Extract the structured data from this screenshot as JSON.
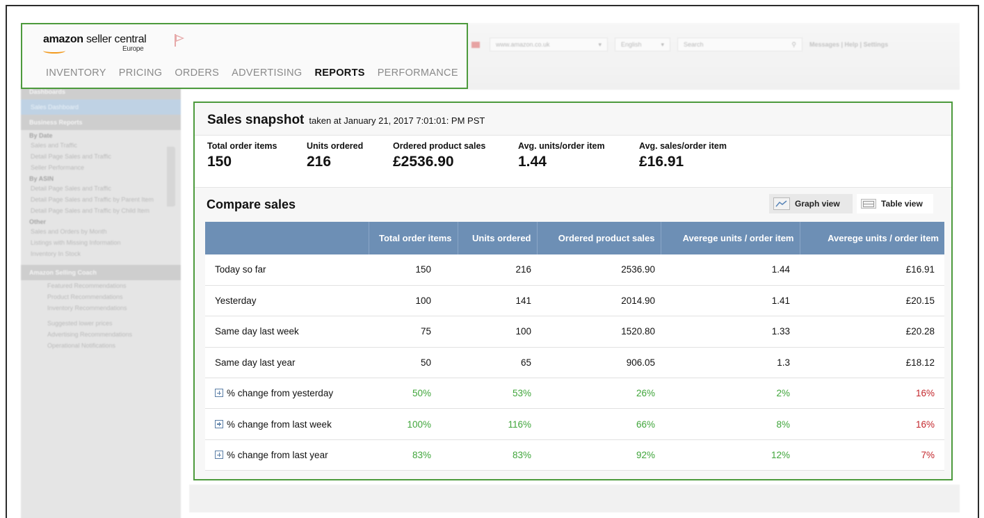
{
  "header": {
    "logo_brand": "amazon",
    "logo_text": "seller central",
    "logo_region": "Europe",
    "nav": [
      "INVENTORY",
      "PRICING",
      "ORDERS",
      "ADVERTISING",
      "REPORTS",
      "PERFORMANCE"
    ],
    "nav_active": "REPORTS",
    "marketplace": "www.amazon.co.uk",
    "language": "English",
    "search_placeholder": "Search",
    "links": "Messages | Help | Settings"
  },
  "sidebar": {
    "sections": [
      {
        "title": "Dashboards",
        "items": [
          {
            "label": "Sales Dashboard",
            "selected": true
          }
        ]
      },
      {
        "title": "Business Reports",
        "groups": [
          {
            "sub": "By Date",
            "items": [
              "Sales and Traffic",
              "Detail Page Sales and Traffic",
              "Seller Performance"
            ]
          },
          {
            "sub": "By ASIN",
            "items": [
              "Detail Page Sales and Traffic",
              "Detail Page Sales and Traffic by Parent Item",
              "Detail Page Sales and Traffic by Child Item"
            ]
          },
          {
            "sub": "Other",
            "items": [
              "Sales and Orders by Month",
              "Listings with Missing Information",
              "Inventory In Stock"
            ]
          }
        ]
      },
      {
        "title": "Amazon Selling Coach",
        "items": [
          "Featured Recommendations",
          "Product Recommendations",
          "Inventory Recommendations",
          "Suggested lower prices",
          "Advertising Recommendations",
          "Operational Notifications"
        ]
      }
    ]
  },
  "snapshot": {
    "title": "Sales snapshot",
    "taken": "taken at January 21, 2017 7:01:01: PM PST",
    "stats": [
      {
        "label": "Total order items",
        "value": "150"
      },
      {
        "label": "Units ordered",
        "value": "216"
      },
      {
        "label": "Ordered product sales",
        "value": "£2536.90"
      },
      {
        "label": "Avg. units/order item",
        "value": "1.44"
      },
      {
        "label": "Avg. sales/order item",
        "value": "£16.91"
      }
    ]
  },
  "compare": {
    "title": "Compare sales",
    "graph_view_label": "Graph view",
    "table_view_label": "Table view",
    "headers": [
      "",
      "Total order items",
      "Units ordered",
      "Ordered product sales",
      "Averege units / order item",
      "Averege units / order item"
    ],
    "rows": [
      {
        "label": "Today so far",
        "expandable": false,
        "cells": [
          "150",
          "216",
          "2536.90",
          "1.44",
          "£16.91"
        ]
      },
      {
        "label": "Yesterday",
        "expandable": false,
        "cells": [
          "100",
          "141",
          "2014.90",
          "1.41",
          "£20.15"
        ]
      },
      {
        "label": "Same day last week",
        "expandable": false,
        "cells": [
          "75",
          "100",
          "1520.80",
          "1.33",
          "£20.28"
        ]
      },
      {
        "label": "Same day last year",
        "expandable": false,
        "cells": [
          "50",
          "65",
          "906.05",
          "1.3",
          "£18.12"
        ]
      },
      {
        "label": "% change from yesterday",
        "expandable": true,
        "cells": [
          "50%",
          "53%",
          "26%",
          "2%",
          "16%"
        ]
      },
      {
        "label": "% change from last week",
        "expandable": true,
        "cells": [
          "100%",
          "116%",
          "66%",
          "8%",
          "16%"
        ]
      },
      {
        "label": "% change from last year",
        "expandable": true,
        "cells": [
          "83%",
          "83%",
          "92%",
          "12%",
          "7%"
        ]
      }
    ],
    "colors": {
      "positive": "#3fa53a",
      "negative": "#c3262b",
      "header_bg": "#6d8fb5"
    }
  }
}
